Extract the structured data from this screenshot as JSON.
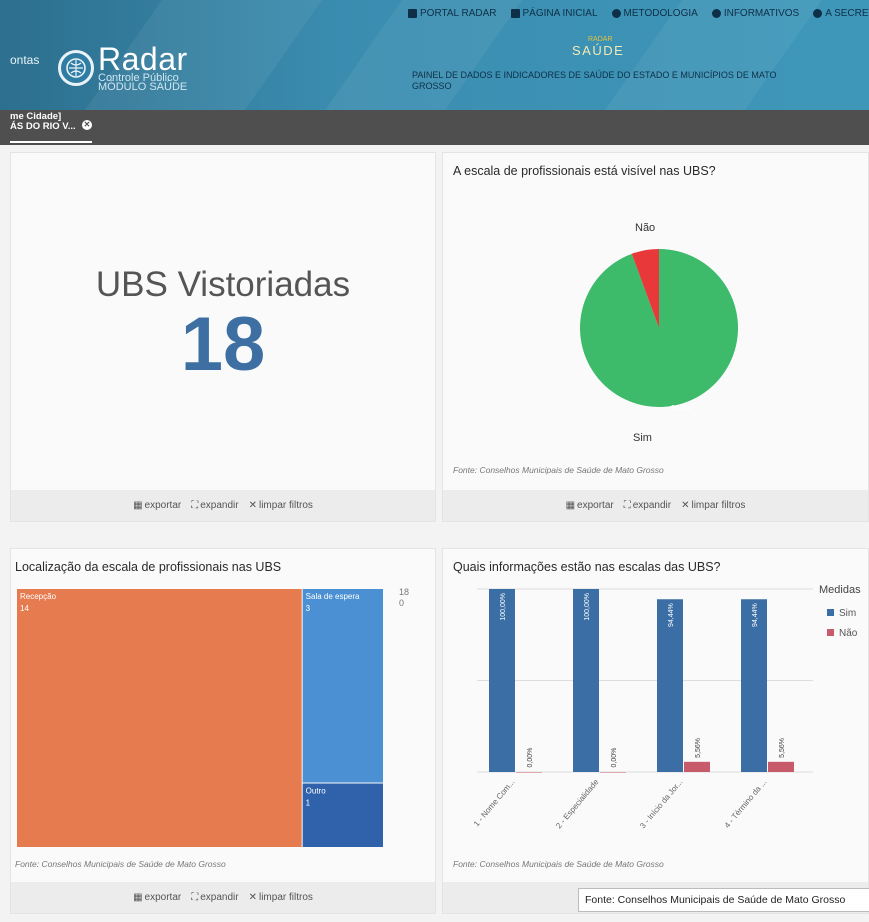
{
  "header": {
    "left_fragment": "ontas",
    "logo_name": "Radar",
    "logo_tag": "TCE",
    "logo_sub_1": "Controle Público",
    "logo_sub_2": "MÓDULO SAÚDE",
    "nav": [
      {
        "label": "PORTAL RADAR",
        "icon": "bookmark-icon"
      },
      {
        "label": "PÁGINA INICIAL",
        "icon": "home-icon"
      },
      {
        "label": "METODOLOGIA",
        "icon": "info-icon"
      },
      {
        "label": "INFORMATIVOS",
        "icon": "info-icon"
      },
      {
        "label": "A SECRETA",
        "icon": "info-icon"
      }
    ],
    "saude_top": "RADAR",
    "saude": "SAÚDE",
    "painel_title": "PAINEL DE DADOS E INDICADORES DE SAÚDE DO ESTADO E MUNICÍPIOS DE MATO GROSSO"
  },
  "filter_chip": {
    "line1": "me Cidade]",
    "line2": "ÁS DO RIO V..."
  },
  "kpi_panel": {
    "label": "UBS Vistoriadas",
    "value": "18"
  },
  "footer_actions": {
    "export": "exportar",
    "expand": "expandir",
    "clear": "limpar filtros"
  },
  "source_note": "Fonte: Conselhos Municipais de Saúde de Mato Grosso",
  "tooltip": "Fonte: Conselhos Municipais de Saúde de Mato Grosso",
  "colors": {
    "header": "#3b8db0",
    "pie_sim": "#3dba6a",
    "pie_nao": "#e8383a",
    "treemap_recepcao": "#e67b50",
    "treemap_sala": "#4a90d2",
    "treemap_outro": "#3062ab",
    "bar_sim": "#3a6ea5",
    "bar_nao": "#c75b6c"
  },
  "chart_data": [
    {
      "type": "pie",
      "title": "A escala de profissionais está visível nas UBS?",
      "labels": [
        "Sim",
        "Não"
      ],
      "values": [
        94.4,
        5.6
      ],
      "data_labels": [
        "94.4%",
        ""
      ]
    },
    {
      "type": "treemap",
      "title": "Localização da escala de profissionais nas UBS",
      "labels": [
        "Recepção",
        "Sala de espera",
        "Outro"
      ],
      "values": [
        14,
        3,
        1
      ],
      "scale_labels": [
        "18",
        "0"
      ]
    },
    {
      "type": "bar",
      "title": "Quais informações estão nas escalas das UBS?",
      "categories": [
        "1 - Nome Com...",
        "2 - Especialidade",
        "3 - Início da Jor...",
        "4 - Término da ..."
      ],
      "series": [
        {
          "name": "Sim",
          "values": [
            100.0,
            100.0,
            94.4,
            94.4
          ],
          "labels": [
            "100,00%",
            "100,00%",
            "94,44%",
            "94,44%"
          ]
        },
        {
          "name": "Não",
          "values": [
            0.0,
            0.0,
            5.56,
            5.56
          ],
          "labels": [
            "0,00%",
            "0,00%",
            "5,56%",
            "5,56%"
          ]
        }
      ],
      "legend_title": "Medidas",
      "legend_position": "right",
      "ylim": [
        0,
        100
      ],
      "grid": true
    }
  ]
}
